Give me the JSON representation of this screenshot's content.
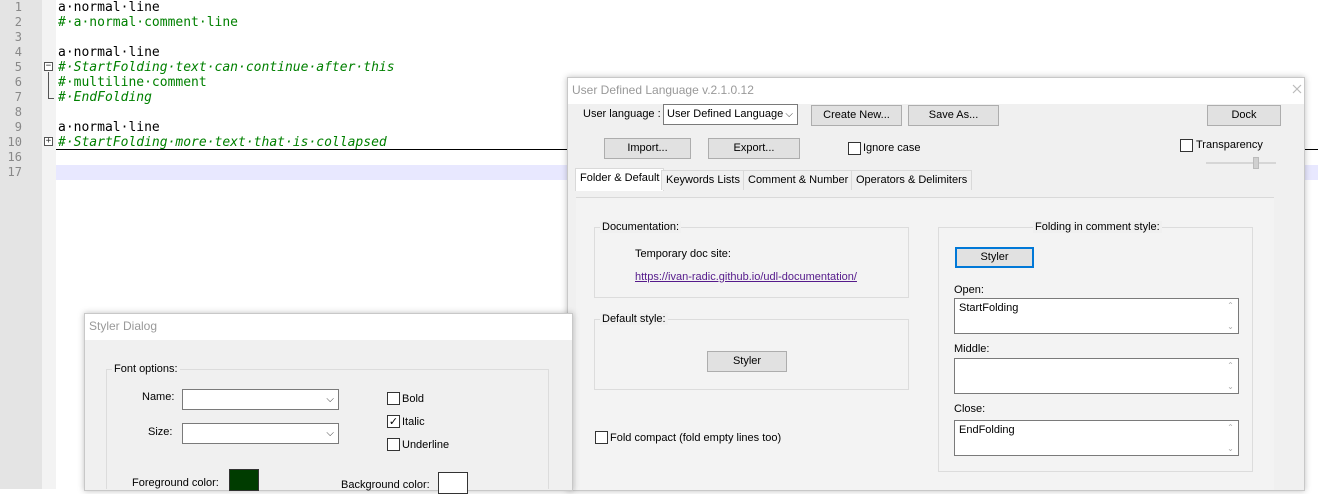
{
  "editor": {
    "line_numbers": [
      "1",
      "2",
      "3",
      "4",
      "5",
      "6",
      "7",
      "8",
      "9",
      "10",
      "16",
      "17"
    ],
    "lines": [
      "a·normal·line",
      "#·a·normal·comment·line",
      "",
      "a·normal·line",
      "#·StartFolding·text·can·continue·after·this",
      "#·multiline·comment",
      "#·EndFolding",
      "",
      "a·normal·line",
      "#·StartFolding·more·text·that·is·collapsed",
      "",
      ""
    ],
    "fold_open_symbol": "−",
    "fold_closed_symbol": "+"
  },
  "udl": {
    "title": "User Defined Language v.2.1.0.12",
    "user_language_label": "User language :",
    "user_language_value": "User Defined Language",
    "create_new_label": "Create New...",
    "save_as_label": "Save As...",
    "dock_label": "Dock",
    "import_label": "Import...",
    "export_label": "Export...",
    "ignore_case_label": "Ignore case",
    "transparency_label": "Transparency",
    "tabs": [
      "Folder & Default",
      "Keywords Lists",
      "Comment & Number",
      "Operators & Delimiters"
    ],
    "documentation_title": "Documentation:",
    "temp_doc_label": "Temporary doc site:",
    "doc_link": "https://ivan-radic.github.io/udl-documentation/",
    "default_style_title": "Default style:",
    "styler_label": "Styler",
    "fold_compact_label": "Fold compact (fold empty lines too)",
    "folding_comment_title": "Folding in comment style:",
    "open_label": "Open:",
    "open_value": "StartFolding",
    "middle_label": "Middle:",
    "middle_value": "",
    "close_label": "Close:",
    "close_value": "EndFolding"
  },
  "styler": {
    "title": "Styler Dialog",
    "font_options_title": "Font options:",
    "name_label": "Name:",
    "size_label": "Size:",
    "bold_label": "Bold",
    "italic_label": "Italic",
    "underline_label": "Underline",
    "italic_checked": "✓",
    "foreground_label": "Foreground color:",
    "background_label": "Background color:",
    "foreground_color": "#003c00",
    "background_color": "#ffffff"
  },
  "icons": {
    "dropdown_arrow": "⌵",
    "scroll_up": "⌃",
    "scroll_down": "⌄"
  }
}
